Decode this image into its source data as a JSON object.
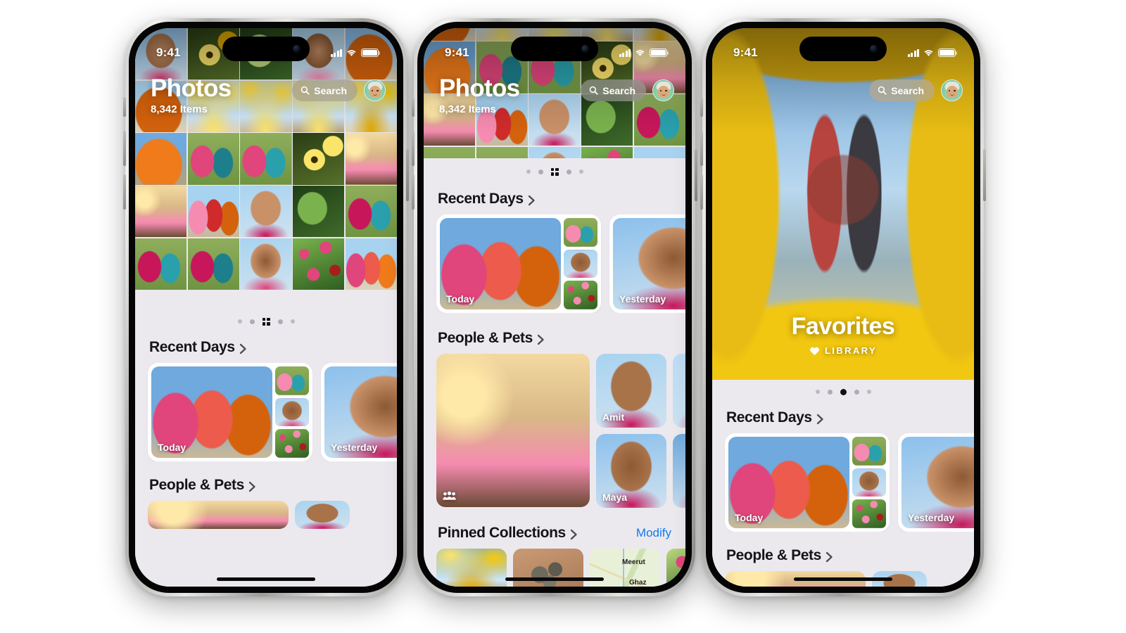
{
  "app": {
    "name": "Photos",
    "bg_color": "#ebe9ee",
    "accent_color": "#1479ec"
  },
  "status_bar": {
    "time": "9:41",
    "cellular_icon": "signal-bars-icon",
    "wifi_icon": "wifi-icon",
    "battery_icon": "battery-icon"
  },
  "nav": {
    "title": "Photos",
    "subtitle": "8,342 Items",
    "search_label": "Search",
    "search_icon": "search-icon",
    "avatar_name": "memoji-avatar"
  },
  "sections": {
    "recent_days": {
      "title": "Recent Days",
      "chevron_icon": "chevron-right-icon",
      "cards": [
        {
          "caption": "Today"
        },
        {
          "caption": "Yesterday"
        }
      ]
    },
    "people_pets": {
      "title": "People & Pets",
      "chevron_icon": "chevron-right-icon",
      "group_badge_icon": "people-group-icon",
      "faces": [
        {
          "name": "Amit"
        },
        {
          "name": "Maya"
        }
      ]
    },
    "pinned_collections": {
      "title": "Pinned Collections",
      "chevron_icon": "chevron-right-icon",
      "modify_label": "Modify",
      "map_labels": [
        "Meerut",
        "Ghaz"
      ]
    }
  },
  "favorites_hero": {
    "title": "Favorites",
    "subtitle": "LIBRARY",
    "heart_icon": "heart-filled-icon"
  },
  "page_indicator": {
    "total_dots": 5,
    "active_index": 2,
    "grid_variant_icon": "grid-squares-icon"
  },
  "phones": [
    {
      "id": "phone-left",
      "view": "library-grid"
    },
    {
      "id": "phone-center",
      "view": "library-scrolled"
    },
    {
      "id": "phone-right",
      "view": "favorites"
    }
  ]
}
